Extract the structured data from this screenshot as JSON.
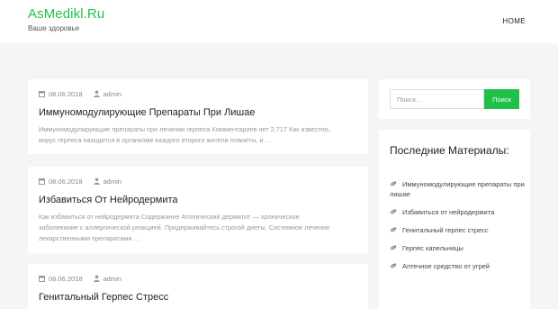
{
  "header": {
    "brand": "AsMedikl.Ru",
    "tagline": "Ваше здоровье",
    "nav_home": "HOME"
  },
  "posts": [
    {
      "date": "08.06.2018",
      "author": "admin",
      "title": "Иммуномодулирующие Препараты При Лишае",
      "excerpt": "Иммуномодулирующие препараты при лечении герпеса Комментариев нет 2,717 Как известно, вирус герпеса находится в организме каждого второго жителя планеты, и …"
    },
    {
      "date": "08.06.2018",
      "author": "admin",
      "title": "Избавиться От Нейродермита",
      "excerpt": "Как избавиться от нейродермита Содержание Атопический дерматит — хроническое заболевание с аллергической реакцией. Придерживайтесь строгой диеты. Системное лечение лекарственными препаратами …"
    },
    {
      "date": "08.06.2018",
      "author": "admin",
      "title": "Генитальный Герпес Стресс",
      "excerpt": ""
    }
  ],
  "search": {
    "placeholder": "Поиск…",
    "button_label": "Поиск"
  },
  "recent": {
    "title": "Последние Материалы:",
    "items": [
      "Иммуномодулирующие препараты при лишае",
      "Избавиться от нейродермита",
      "Генитальный герпес стресс",
      "Герпес капельницы",
      "Аптечное средство от угрей"
    ]
  },
  "colors": {
    "accent": "#1fc14a",
    "background": "#f5f5f5",
    "muted_text": "#999999"
  },
  "icons": {
    "date": "calendar-icon",
    "author": "user-icon",
    "list_bullet": "leaf-icon"
  }
}
